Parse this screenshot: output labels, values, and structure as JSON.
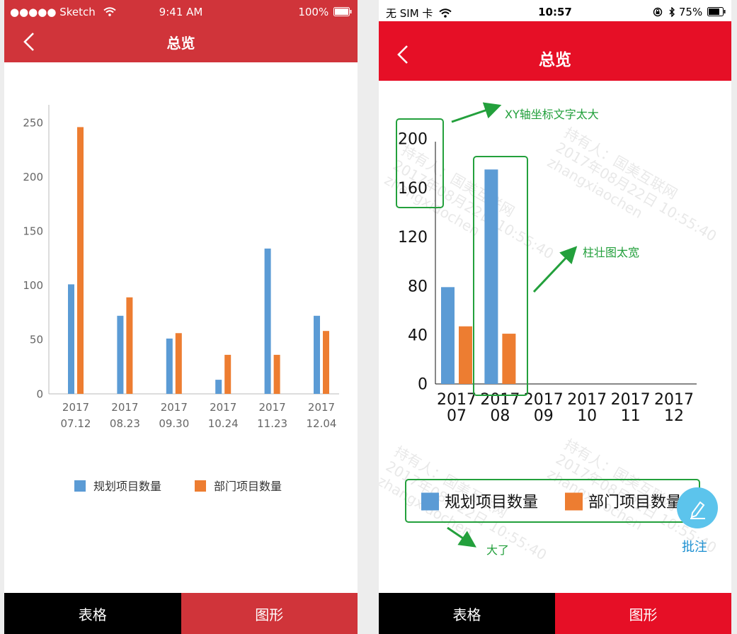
{
  "left_screen": {
    "status": {
      "carrier": "●●●●● Sketch",
      "time": "9:41 AM",
      "battery": "100%"
    },
    "nav_title": "总览",
    "tabs": [
      "表格",
      "图形"
    ],
    "chart_data": {
      "type": "bar",
      "categories": [
        [
          "2017",
          "07.12"
        ],
        [
          "2017",
          "08.23"
        ],
        [
          "2017",
          "09.30"
        ],
        [
          "2017",
          "10.24"
        ],
        [
          "2017",
          "11.23"
        ],
        [
          "2017",
          "12.04"
        ]
      ],
      "series": [
        {
          "name": "规划项目数量",
          "color": "#5b9bd5",
          "values": [
            101,
            72,
            51,
            13,
            134,
            72
          ]
        },
        {
          "name": "部门项目数量",
          "color": "#ed7d31",
          "values": [
            246,
            89,
            56,
            36,
            36,
            58
          ]
        }
      ],
      "yticks": [
        0,
        50,
        100,
        150,
        200,
        250
      ],
      "ylim": [
        0,
        260
      ],
      "legend_position": "bottom"
    }
  },
  "right_screen": {
    "status": {
      "carrier": "无 SIM 卡",
      "time": "10:57",
      "battery": "75%"
    },
    "nav_title": "总览",
    "tabs": [
      "表格",
      "图形"
    ],
    "chart_data": {
      "type": "bar",
      "categories": [
        [
          "2017",
          "07"
        ],
        [
          "2017",
          "08"
        ],
        [
          "2017",
          "09"
        ],
        [
          "2017",
          "10"
        ],
        [
          "2017",
          "11"
        ],
        [
          "2017",
          "12"
        ]
      ],
      "series": [
        {
          "name": "规划项目数量",
          "color": "#5b9bd5",
          "values": [
            79,
            175,
            null,
            null,
            null,
            null
          ]
        },
        {
          "name": "部门项目数量",
          "color": "#ed7d31",
          "values": [
            47,
            41,
            null,
            null,
            null,
            null
          ]
        }
      ],
      "yticks": [
        0,
        40,
        80,
        120,
        160,
        200
      ],
      "ylim": [
        0,
        200
      ],
      "legend_position": "bottom"
    },
    "watermark": [
      "持有人：国美互联网",
      "2017年08月22日 10:55:40",
      "zhangxiaochen"
    ],
    "annotations": {
      "axis_text": "XY轴坐标文字太大",
      "bar_width": "柱壮图太宽",
      "legend": "大了"
    },
    "fab_label": "批注"
  },
  "colors": {
    "left_nav": "#d0343a",
    "right_nav": "#e60f26",
    "annotation": "#23a03c",
    "tab_dark": "#000000"
  }
}
